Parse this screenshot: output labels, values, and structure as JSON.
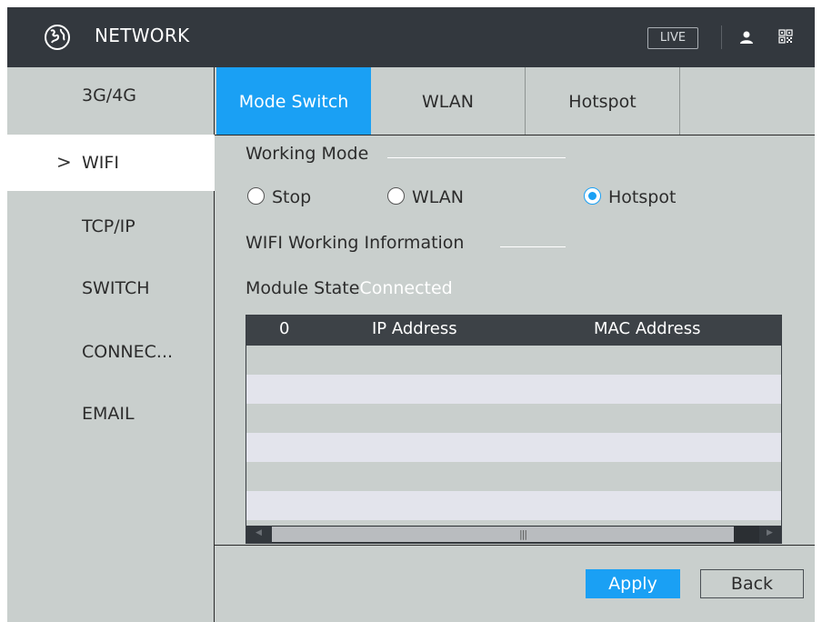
{
  "header": {
    "title": "NETWORK",
    "live_label": "LIVE",
    "icons": [
      "globe-icon",
      "user-icon",
      "qr-code-icon"
    ]
  },
  "sidebar": {
    "items": [
      {
        "label": "3G/4G"
      },
      {
        "label": "WIFI",
        "active": true,
        "marker": ">"
      },
      {
        "label": "TCP/IP"
      },
      {
        "label": "SWITCH"
      },
      {
        "label": "CONNEC..."
      },
      {
        "label": "EMAIL"
      }
    ]
  },
  "tabs": [
    {
      "label": "Mode Switch",
      "selected": true
    },
    {
      "label": "WLAN"
    },
    {
      "label": "Hotspot"
    }
  ],
  "working_mode": {
    "title": "Working Mode",
    "options": [
      {
        "label": "Stop",
        "checked": false
      },
      {
        "label": "WLAN",
        "checked": false
      },
      {
        "label": "Hotspot",
        "checked": true
      }
    ]
  },
  "wifi_info": {
    "title": "WIFI Working Information",
    "module_state_label": "Module State",
    "module_state_value": "Connected"
  },
  "table": {
    "columns": [
      "0",
      "IP Address",
      "MAC Address"
    ],
    "rows": []
  },
  "footer": {
    "apply_label": "Apply",
    "back_label": "Back"
  },
  "colors": {
    "accent": "#1aa0f4",
    "titlebar": "#33383e",
    "panel": "#c9cfcd"
  }
}
